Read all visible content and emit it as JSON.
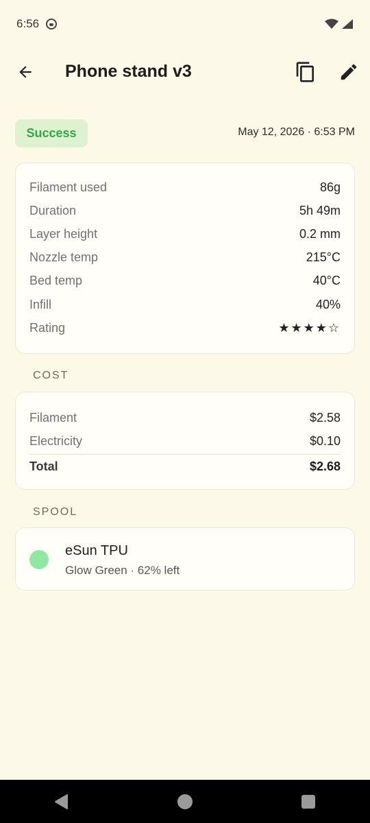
{
  "status_bar": {
    "time": "6:56"
  },
  "header": {
    "title": "Phone stand v3"
  },
  "print": {
    "status": "Success",
    "datetime": "May 12, 2026 · 6:53 PM",
    "details": [
      {
        "label": "Filament used",
        "value": "86g"
      },
      {
        "label": "Duration",
        "value": "5h 49m"
      },
      {
        "label": "Layer height",
        "value": "0.2 mm"
      },
      {
        "label": "Nozzle temp",
        "value": "215°C"
      },
      {
        "label": "Bed temp",
        "value": "40°C"
      },
      {
        "label": "Infill",
        "value": "40%"
      },
      {
        "label": "Rating",
        "value": "★★★★☆",
        "rating": 4,
        "rating_max": 5
      }
    ]
  },
  "cost": {
    "section_label": "COST",
    "rows": [
      {
        "label": "Filament",
        "value": "$2.58"
      },
      {
        "label": "Electricity",
        "value": "$0.10"
      }
    ],
    "total": {
      "label": "Total",
      "value": "$2.68"
    }
  },
  "spool": {
    "section_label": "SPOOL",
    "name": "eSun TPU",
    "subtitle": "Glow Green · 62% left",
    "color": "#8fe8a2",
    "remaining_percent": 62
  },
  "colors": {
    "background": "#fdf9e8",
    "success_bg": "#dff2d0",
    "success_text": "#2ea84a"
  },
  "icons": {
    "back": "arrow-left-icon",
    "copy": "copy-icon",
    "edit": "pencil-icon",
    "wifi": "wifi-icon",
    "signal": "signal-icon",
    "nav_back": "triangle-back-icon",
    "nav_home": "circle-home-icon",
    "nav_recents": "square-recents-icon"
  }
}
